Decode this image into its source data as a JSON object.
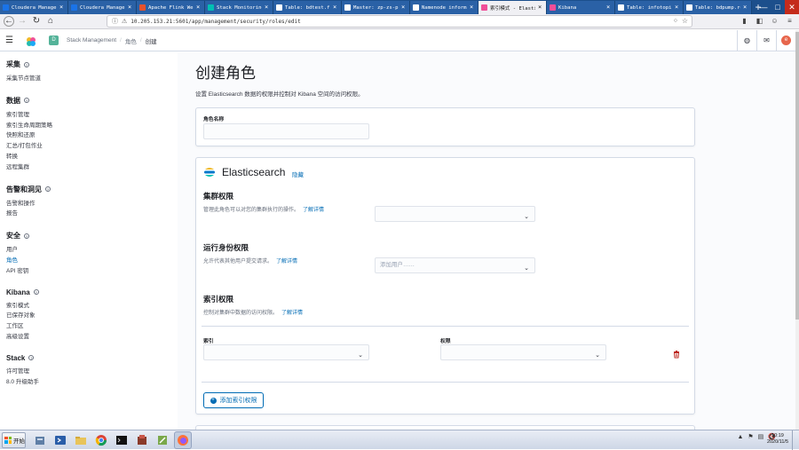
{
  "browser": {
    "tabs": [
      {
        "label": "Cloudera Manager",
        "color": "#1a73e8"
      },
      {
        "label": "Cloudera Manager",
        "color": "#1a73e8"
      },
      {
        "label": "Apache Flink Web",
        "color": "#e6522c"
      },
      {
        "label": "Stack Monitoring",
        "color": "#00bfb3"
      },
      {
        "label": "Table: bdtest.fund_i",
        "color": "#ffffff"
      },
      {
        "label": "Master: zp-zs-prd-h",
        "color": "#ffffff"
      },
      {
        "label": "Namenode information",
        "color": "#ffffff"
      },
      {
        "label": "索引模式 - Elastic",
        "color": "#f04e98"
      },
      {
        "label": "Kibana",
        "color": "#f04e98"
      },
      {
        "label": "Table: infotopic.bd_",
        "color": "#ffffff"
      },
      {
        "label": "Table: bdpump.reg_s",
        "color": "#ffffff"
      }
    ],
    "active_tab_index": 7,
    "url": "10.205.153.21:5601/app/management/security/roles/edit"
  },
  "header": {
    "space_initial": "D",
    "breadcrumbs": [
      "Stack Management",
      "角色",
      "创建"
    ],
    "avatar_initial": "e"
  },
  "sidenav": {
    "groups": [
      {
        "title": "采集",
        "items": [
          "采集节点管道"
        ]
      },
      {
        "title": "数据",
        "items": [
          "索引管理",
          "索引生命周期策略",
          "快照和还原",
          "汇总/打包作业",
          "转换",
          "远程集群"
        ]
      },
      {
        "title": "告警和洞见",
        "items": [
          "告警和操作",
          "报告"
        ]
      },
      {
        "title": "安全",
        "items": [
          "用户",
          "角色",
          "API 密钥"
        ]
      },
      {
        "title": "Kibana",
        "items": [
          "索引模式",
          "已保存对象",
          "工作区",
          "高级设置"
        ]
      },
      {
        "title": "Stack",
        "items": [
          "许可管理",
          "8.0 升级助手"
        ]
      }
    ],
    "selected": "角色"
  },
  "main": {
    "title": "创建角色",
    "description": "设置 Elasticsearch 数据的权限并控制对 Kibana 空间的访问权限。",
    "role_name_label": "角色名称",
    "es_panel": {
      "title": "Elasticsearch",
      "hide_link": "隐藏",
      "cluster": {
        "title": "集群权限",
        "desc": "管理此角色可以对您的集群执行的操作。",
        "link": "了解详情"
      },
      "runas": {
        "title": "运行身份权限",
        "desc": "允许代表其他用户提交请求。",
        "link": "了解详情",
        "placeholder": "添加用户……"
      },
      "index": {
        "title": "索引权限",
        "desc": "控制对集群中数据的访问权限。",
        "link": "了解详情",
        "indices_label": "索引",
        "privileges_label": "权限"
      },
      "add_button": "添加索引权限"
    }
  },
  "taskbar": {
    "start_label": "开始",
    "clock_time": "10:19",
    "clock_date": "2020/11/5"
  }
}
